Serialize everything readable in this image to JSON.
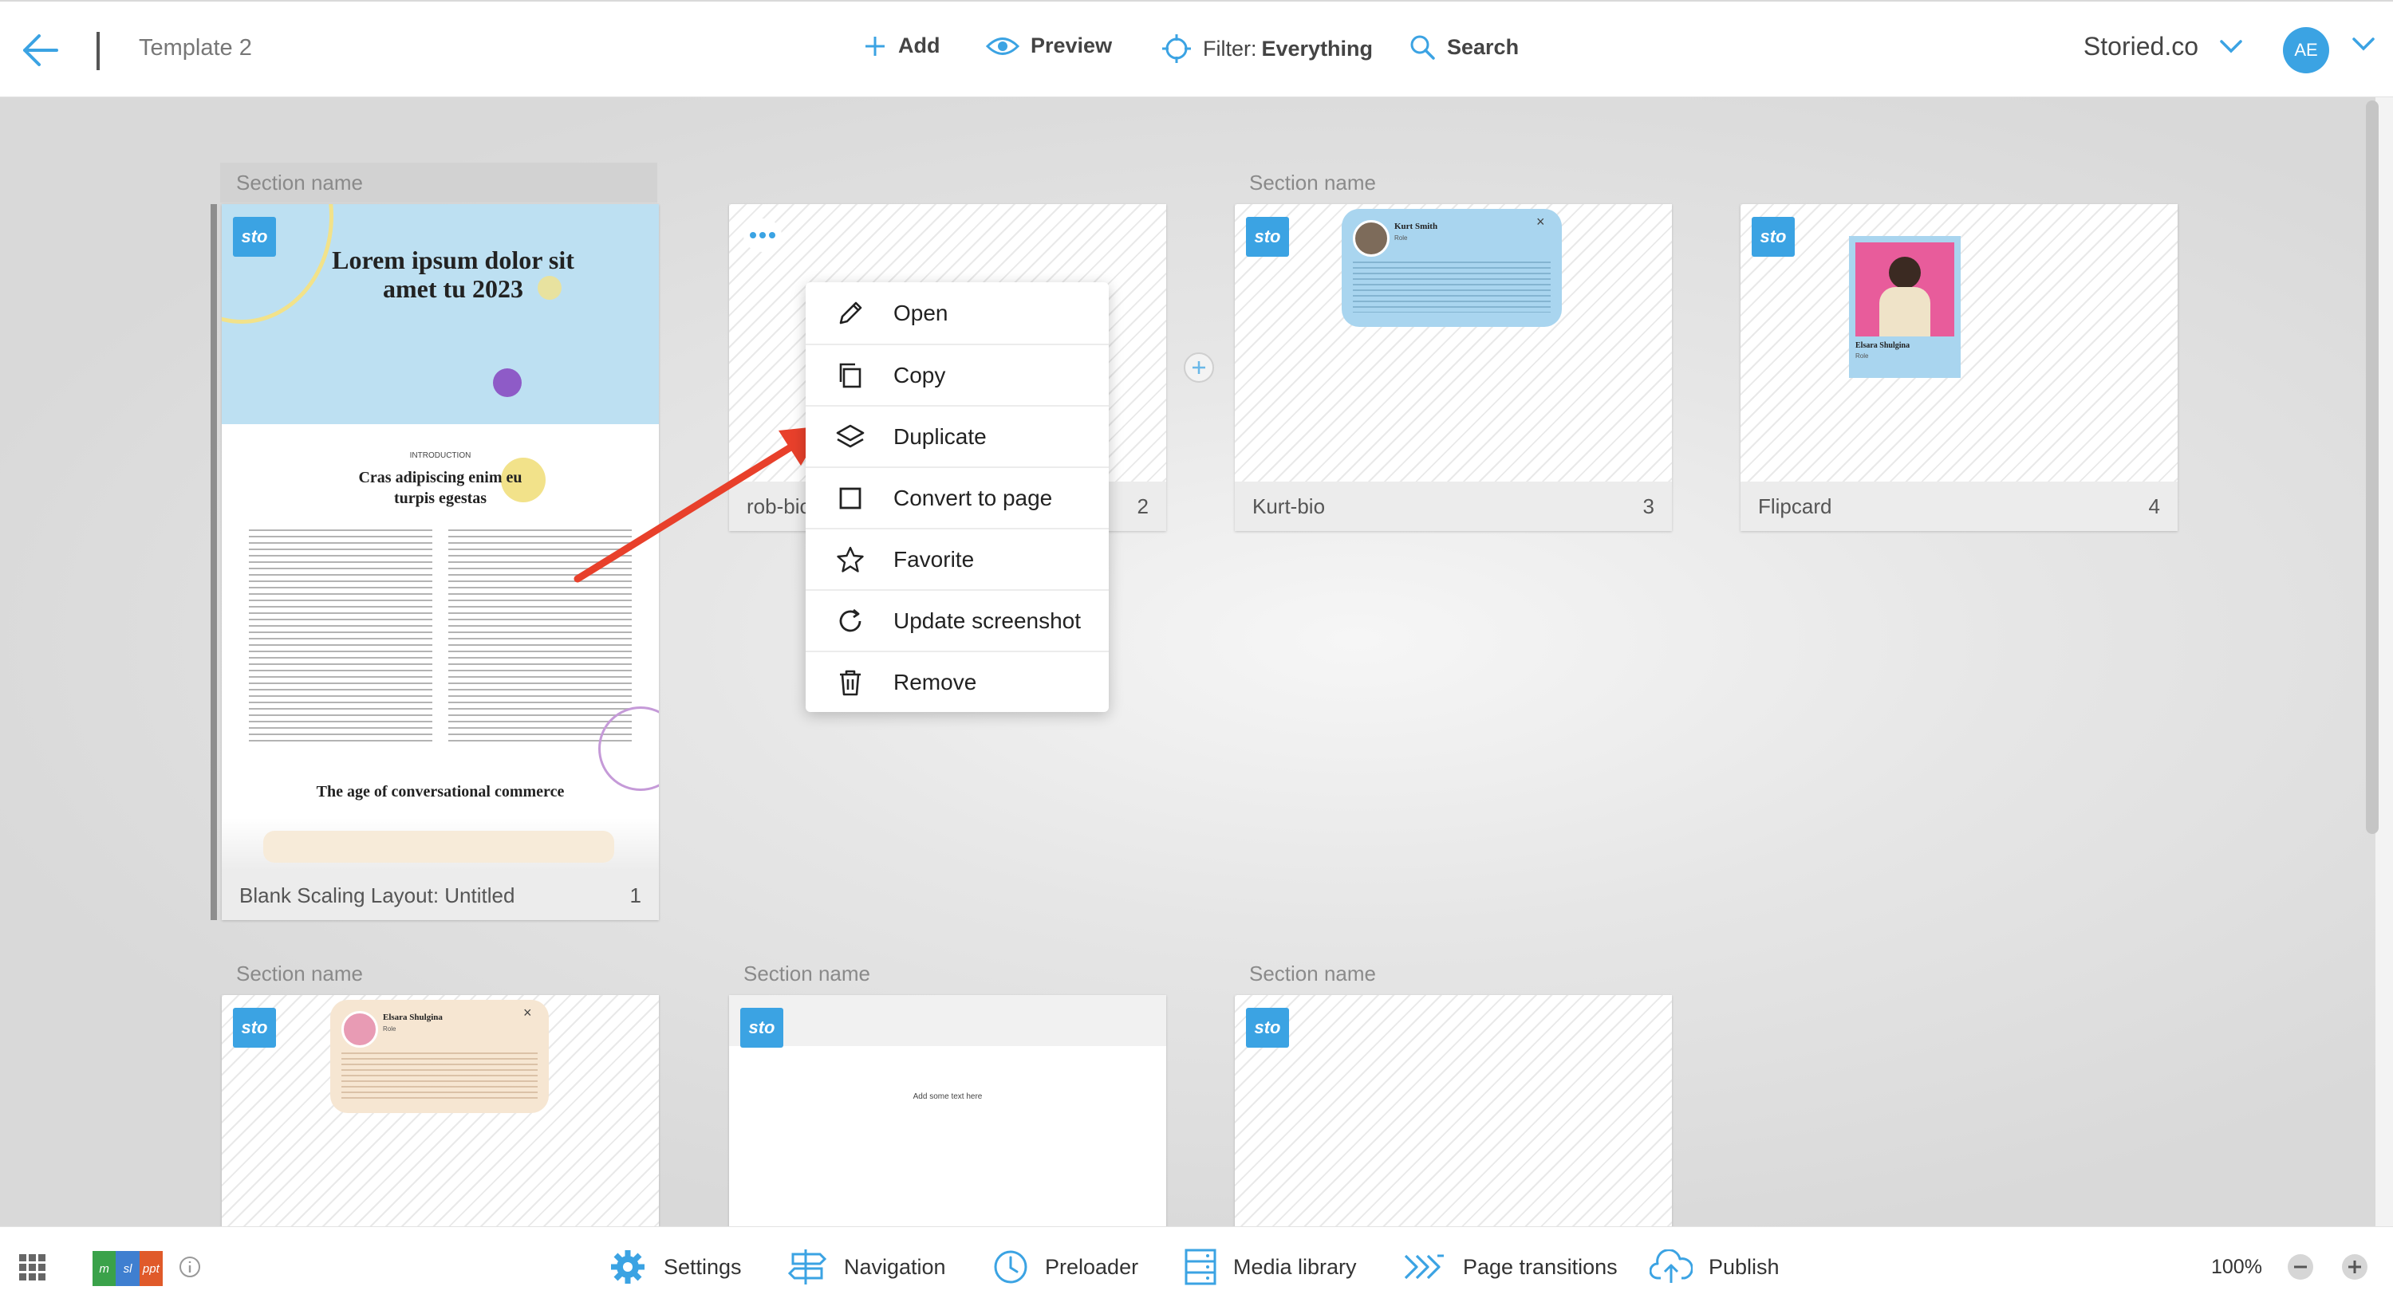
{
  "topbar": {
    "doc_title": "Template 2",
    "add_label": "Add",
    "preview_label": "Preview",
    "filter_prefix": "Filter:",
    "filter_value": "Everything",
    "search_label": "Search",
    "brand": "Storied.co",
    "avatar_initials": "AE"
  },
  "sections": [
    {
      "label": "Section name",
      "card_title": "Blank Scaling Layout: Untitled",
      "number": "1"
    },
    {
      "label": "",
      "card_title": "rob-bic",
      "number": "2"
    },
    {
      "label": "Section name",
      "card_title": "Kurt-bio",
      "number": "3"
    },
    {
      "label": "",
      "card_title": "Flipcard",
      "number": "4"
    },
    {
      "label": "Section name",
      "card_title": "",
      "number": ""
    },
    {
      "label": "Section name",
      "card_title": "",
      "number": ""
    },
    {
      "label": "Section name",
      "card_title": "",
      "number": ""
    }
  ],
  "badge": "sto",
  "card1_preview": {
    "heading": "Lorem ipsum dolor sit amet tu 2023",
    "intro_label": "INTRODUCTION",
    "subheading": "Cras adipiscing enim eu turpis egestas",
    "footer_heading": "The age of conversational commerce"
  },
  "bio_kurt": {
    "name": "Kurt Smith",
    "role": "Role"
  },
  "bio_elsara": {
    "name": "Elsara Shulgina",
    "role": "Role"
  },
  "card6_text": "Add some text here",
  "context_menu": {
    "items": [
      {
        "label": "Open",
        "icon": "pencil-icon"
      },
      {
        "label": "Copy",
        "icon": "copy-icon"
      },
      {
        "label": "Duplicate",
        "icon": "layers-icon"
      },
      {
        "label": "Convert to page",
        "icon": "square-icon"
      },
      {
        "label": "Favorite",
        "icon": "star-icon"
      },
      {
        "label": "Update screenshot",
        "icon": "refresh-icon"
      },
      {
        "label": "Remove",
        "icon": "trash-icon"
      }
    ]
  },
  "bottombar": {
    "logo_parts": [
      "m",
      "sl",
      "ppt"
    ],
    "settings": "Settings",
    "navigation": "Navigation",
    "preloader": "Preloader",
    "media_library": "Media library",
    "page_transitions": "Page transitions",
    "publish": "Publish",
    "zoom": "100%"
  },
  "colors": {
    "accent": "#3ba3e3",
    "arrow": "#e8402b"
  }
}
